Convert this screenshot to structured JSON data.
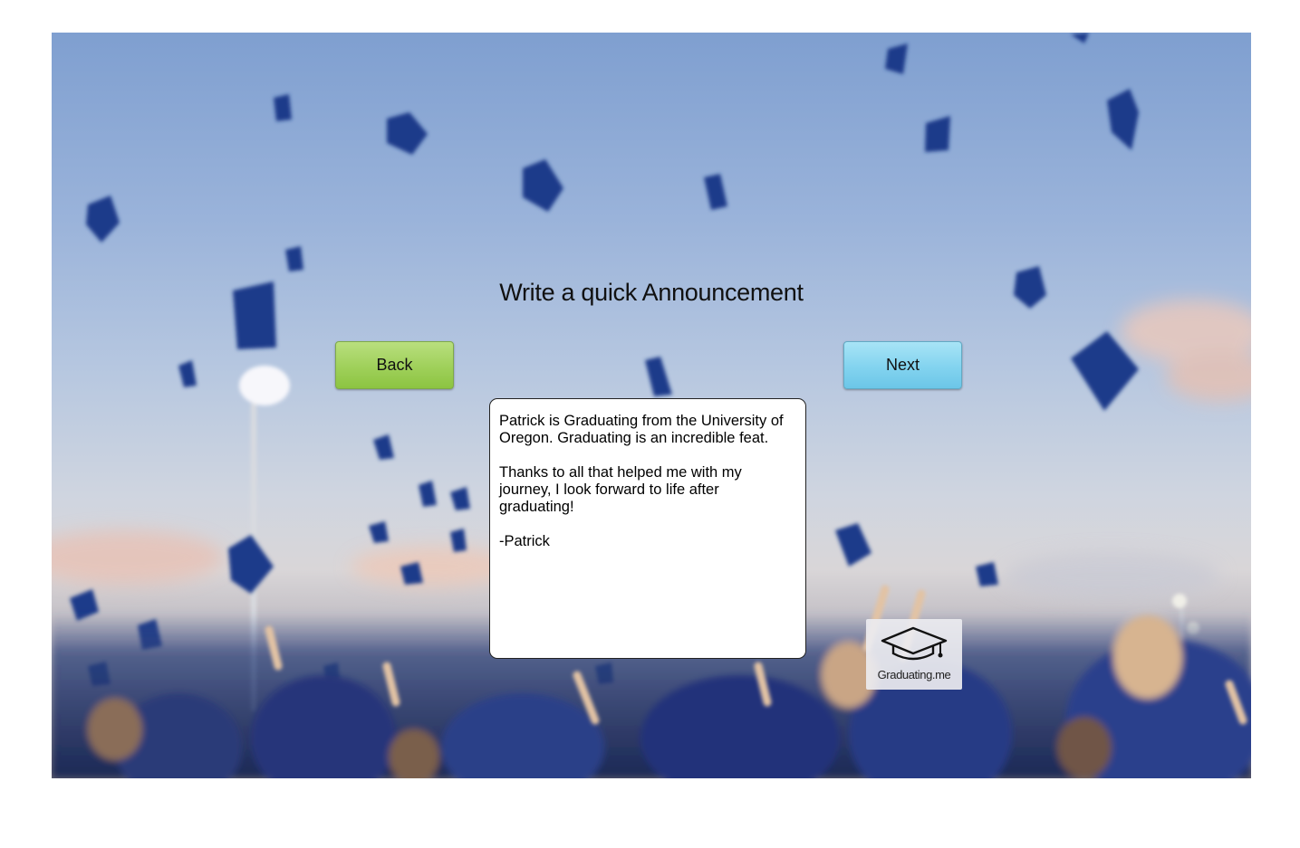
{
  "page": {
    "title": "Write a quick Announcement"
  },
  "buttons": {
    "back_label": "Back",
    "next_label": "Next",
    "back_color": "#9fd05a",
    "next_color": "#82d3ef"
  },
  "announcement": {
    "text": "Patrick is Graduating from the University of Oregon. Graduating is an incredible feat.\n\nThanks to all that helped me with my journey, I look forward to life after graduating!\n\n-Patrick"
  },
  "logo": {
    "icon": "graduation-cap-icon",
    "text": "Graduating.me"
  },
  "background": {
    "description_icon": "graduation-caps-background"
  }
}
